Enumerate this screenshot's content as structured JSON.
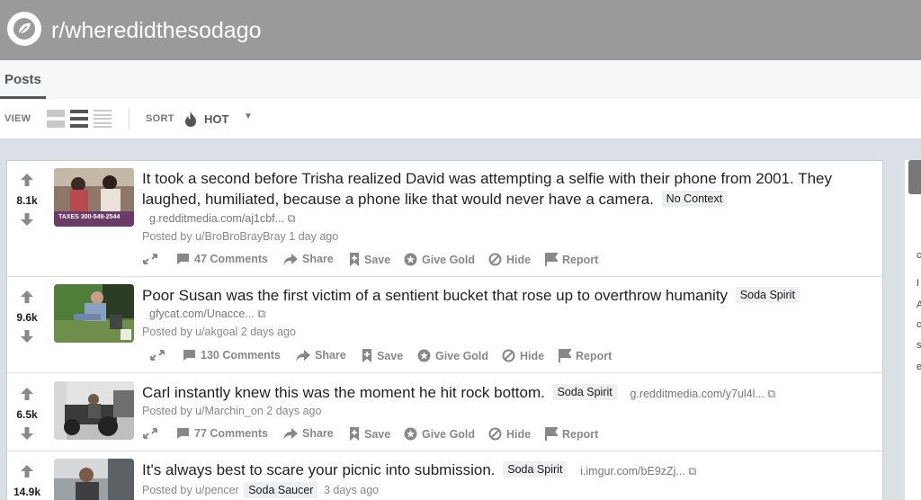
{
  "header": {
    "subreddit": "r/wheredidthesodago"
  },
  "tabs": [
    {
      "label": "Posts"
    }
  ],
  "viewbar": {
    "view_label": "VIEW",
    "sort_label": "SORT",
    "sort_value": "HOT"
  },
  "colors": {
    "header_bg": "#9a9a9a",
    "page_bg": "#dae0e6",
    "flair_bg": "#edeff1"
  },
  "posts": [
    {
      "score": "8.1k",
      "title": "It took a second before Trisha realized David was attempting a selfie with their phone from 2001. They laughed, humiliated, because a phone like that would never have a camera.",
      "flair": "No Context",
      "domain": "g.redditmedia.com/aj1cbf...",
      "posted_by": "Posted by u/BroBroBrayBray 1 day ago",
      "comments": "47 Comments",
      "thumb_caption": "TAXES 300-549-2544"
    },
    {
      "score": "9.6k",
      "title": "Poor Susan was the first victim of a sentient bucket that rose up to overthrow humanity",
      "flair": "Soda Spirit",
      "domain": "gfycat.com/Unacce...",
      "posted_by": "Posted by u/akgoal 2 days ago",
      "comments": "130 Comments"
    },
    {
      "score": "6.5k",
      "title": "Carl instantly knew this was the moment he hit rock bottom.",
      "flair": "Soda Spirit",
      "domain": "g.redditmedia.com/y7ul4l...",
      "posted_by": "Posted by u/Marchin_on 2 days ago",
      "comments": "77 Comments"
    },
    {
      "score": "14.9k",
      "title": "It's always best to scare your picnic into submission.",
      "flair": "Soda Spirit",
      "domain": "i.imgur.com/bE9zZj...",
      "posted_by": "Posted by u/pencer",
      "user_flair": "Soda Saucer",
      "time": "3 days ago"
    }
  ],
  "actions": {
    "share": "Share",
    "save": "Save",
    "give_gold": "Give Gold",
    "hide": "Hide",
    "report": "Report"
  },
  "sidebar_fragments": [
    "c",
    "I",
    "A",
    "c",
    "s",
    "e"
  ]
}
